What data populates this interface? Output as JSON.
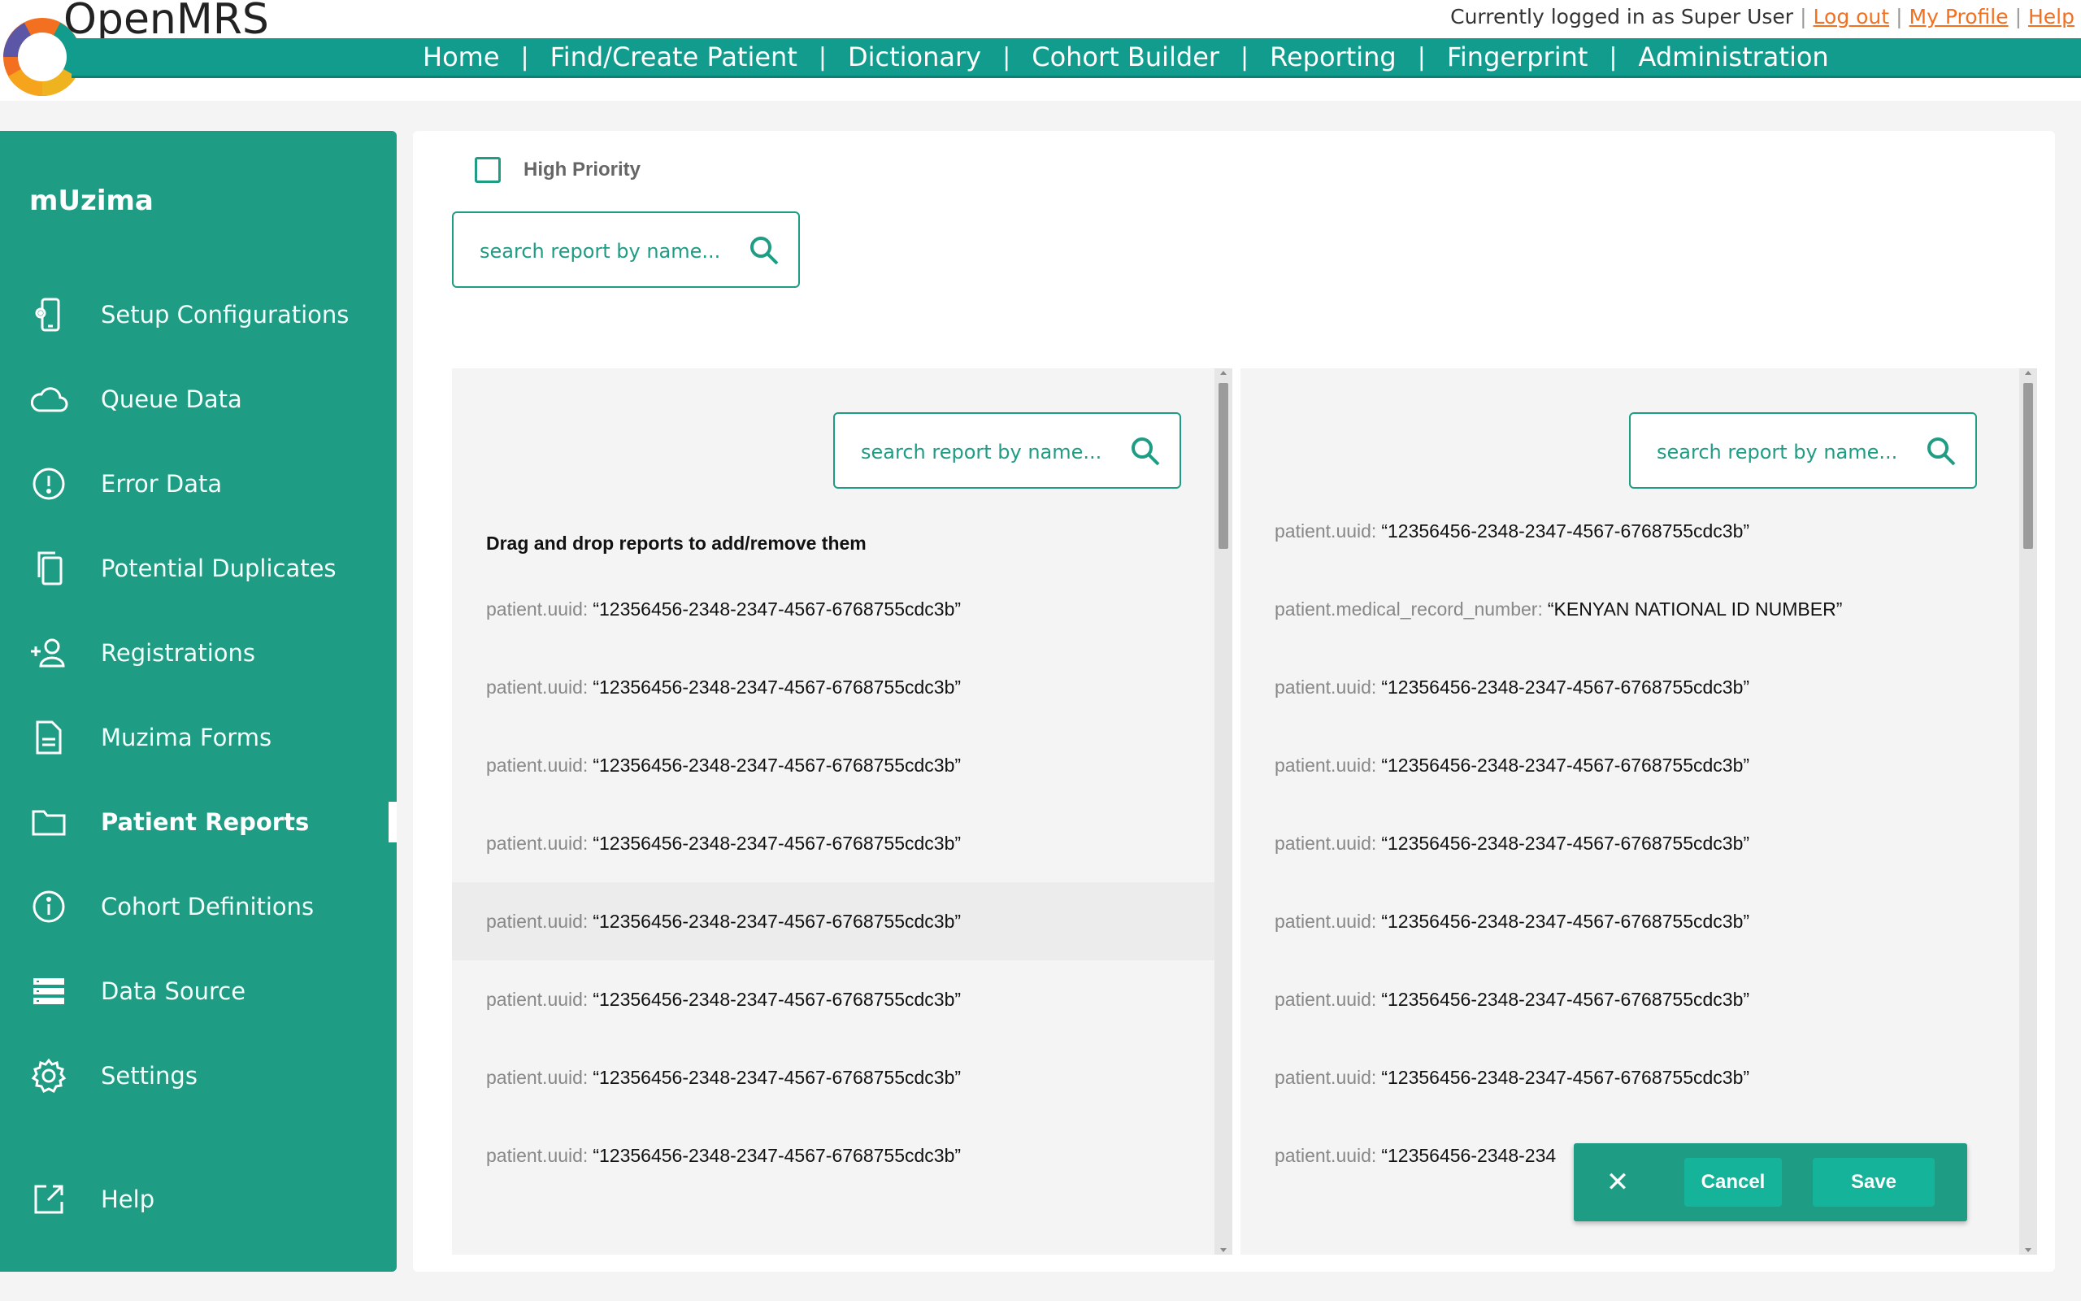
{
  "header": {
    "brand": "OpenMRS",
    "logged_in_text": "Currently logged in as Super User",
    "links": {
      "logout": "Log out",
      "profile": "My Profile",
      "help": "Help"
    },
    "nav": [
      "Home",
      "Find/Create Patient",
      "Dictionary",
      "Cohort Builder",
      "Reporting",
      "Fingerprint",
      "Administration"
    ]
  },
  "sidebar": {
    "title": "mUzima",
    "items": [
      {
        "label": "Setup Configurations",
        "icon": "phone-gear-icon"
      },
      {
        "label": "Queue Data",
        "icon": "cloud-icon"
      },
      {
        "label": "Error Data",
        "icon": "alert-circle-icon"
      },
      {
        "label": "Potential Duplicates",
        "icon": "copy-icon"
      },
      {
        "label": "Registrations",
        "icon": "add-user-icon"
      },
      {
        "label": "Muzima Forms",
        "icon": "document-icon"
      },
      {
        "label": "Patient Reports",
        "icon": "folder-icon",
        "active": true
      },
      {
        "label": "Cohort Definitions",
        "icon": "info-circle-icon"
      },
      {
        "label": "Data Source",
        "icon": "server-icon"
      },
      {
        "label": "Settings",
        "icon": "gear-icon"
      },
      {
        "label": "Help",
        "icon": "external-link-icon"
      }
    ]
  },
  "main": {
    "high_priority_label": "High Priority",
    "search_placeholder": "search report by name...",
    "left_pane": {
      "search_placeholder": "search report by name...",
      "instruction": "Drag and drop reports to add/remove them",
      "rows": [
        {
          "key": "patient.uuid:",
          "value": "“12356456-2348-2347-4567-6768755cdc3b”"
        },
        {
          "key": "patient.uuid:",
          "value": "“12356456-2348-2347-4567-6768755cdc3b”"
        },
        {
          "key": "patient.uuid:",
          "value": "“12356456-2348-2347-4567-6768755cdc3b”"
        },
        {
          "key": "patient.uuid:",
          "value": "“12356456-2348-2347-4567-6768755cdc3b”"
        },
        {
          "key": "patient.uuid:",
          "value": "“12356456-2348-2347-4567-6768755cdc3b”"
        },
        {
          "key": "patient.uuid:",
          "value": "“12356456-2348-2347-4567-6768755cdc3b”"
        },
        {
          "key": "patient.uuid:",
          "value": "“12356456-2348-2347-4567-6768755cdc3b”"
        },
        {
          "key": "patient.uuid:",
          "value": "“12356456-2348-2347-4567-6768755cdc3b”"
        }
      ]
    },
    "right_pane": {
      "search_placeholder": "search report by name...",
      "rows": [
        {
          "key": "patient.uuid:",
          "value": "“12356456-2348-2347-4567-6768755cdc3b”"
        },
        {
          "key": "patient.medical_record_number:",
          "value": "“KENYAN NATIONAL ID NUMBER”"
        },
        {
          "key": "patient.uuid:",
          "value": "“12356456-2348-2347-4567-6768755cdc3b”"
        },
        {
          "key": "patient.uuid:",
          "value": "“12356456-2348-2347-4567-6768755cdc3b”"
        },
        {
          "key": "patient.uuid:",
          "value": "“12356456-2348-2347-4567-6768755cdc3b”"
        },
        {
          "key": "patient.uuid:",
          "value": "“12356456-2348-2347-4567-6768755cdc3b”"
        },
        {
          "key": "patient.uuid:",
          "value": "“12356456-2348-2347-4567-6768755cdc3b”"
        },
        {
          "key": "patient.uuid:",
          "value": "“12356456-2348-2347-4567-6768755cdc3b”"
        },
        {
          "key": "patient.uuid:",
          "value": "“12356456-2348-234"
        }
      ]
    },
    "actions": {
      "cancel": "Cancel",
      "save": "Save",
      "close_glyph": "✕"
    }
  },
  "colors": {
    "brand_teal": "#1e9c84",
    "nav_teal": "#119c8e",
    "link_orange": "#f37021"
  }
}
